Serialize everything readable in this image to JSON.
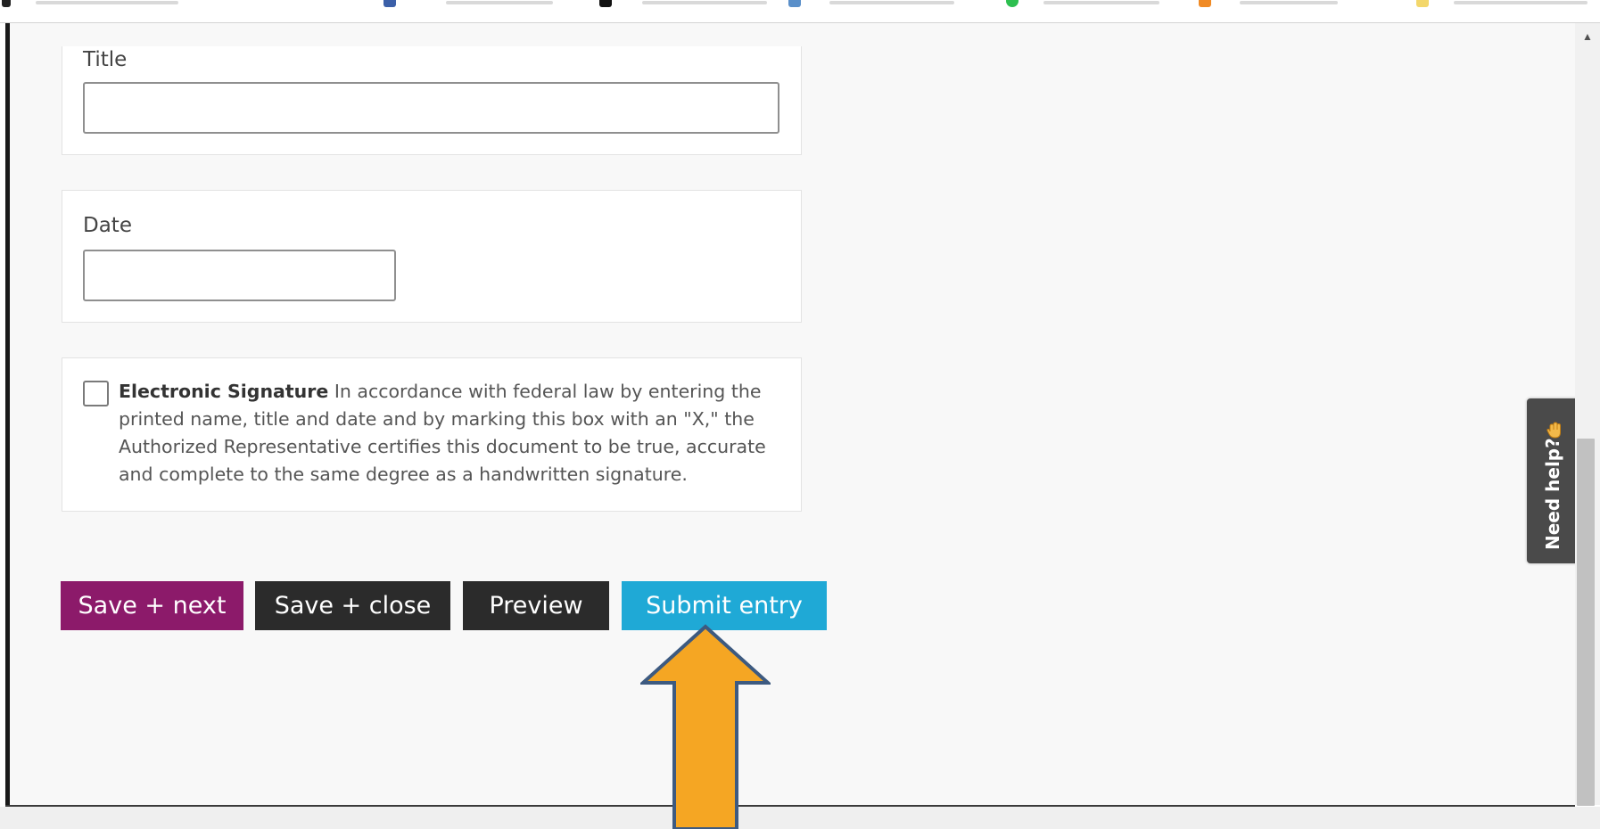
{
  "form": {
    "title_field": {
      "label": "Title",
      "value": ""
    },
    "date_field": {
      "label": "Date",
      "value": ""
    },
    "signature": {
      "checked": false,
      "heading": "Electronic Signature",
      "text": "In accordance with federal law by entering the printed name, title and date and by marking this box with an \"X,\" the Authorized Representative certifies this document to be true, accurate and complete to the same degree as a handwritten signature."
    }
  },
  "actions": {
    "save_next": "Save + next",
    "save_close": "Save + close",
    "preview": "Preview",
    "submit": "Submit entry"
  },
  "help_tab": {
    "label": "Need help?",
    "icon": "hand-wave-icon"
  },
  "annotation": {
    "arrow_color": "#f5a623",
    "arrow_outline": "#3d5a80",
    "points_to": "submit-entry-button"
  },
  "colors": {
    "save_next_bg": "#8c1a6a",
    "dark_button_bg": "#2b2b2b",
    "submit_bg": "#1fa9d6"
  }
}
